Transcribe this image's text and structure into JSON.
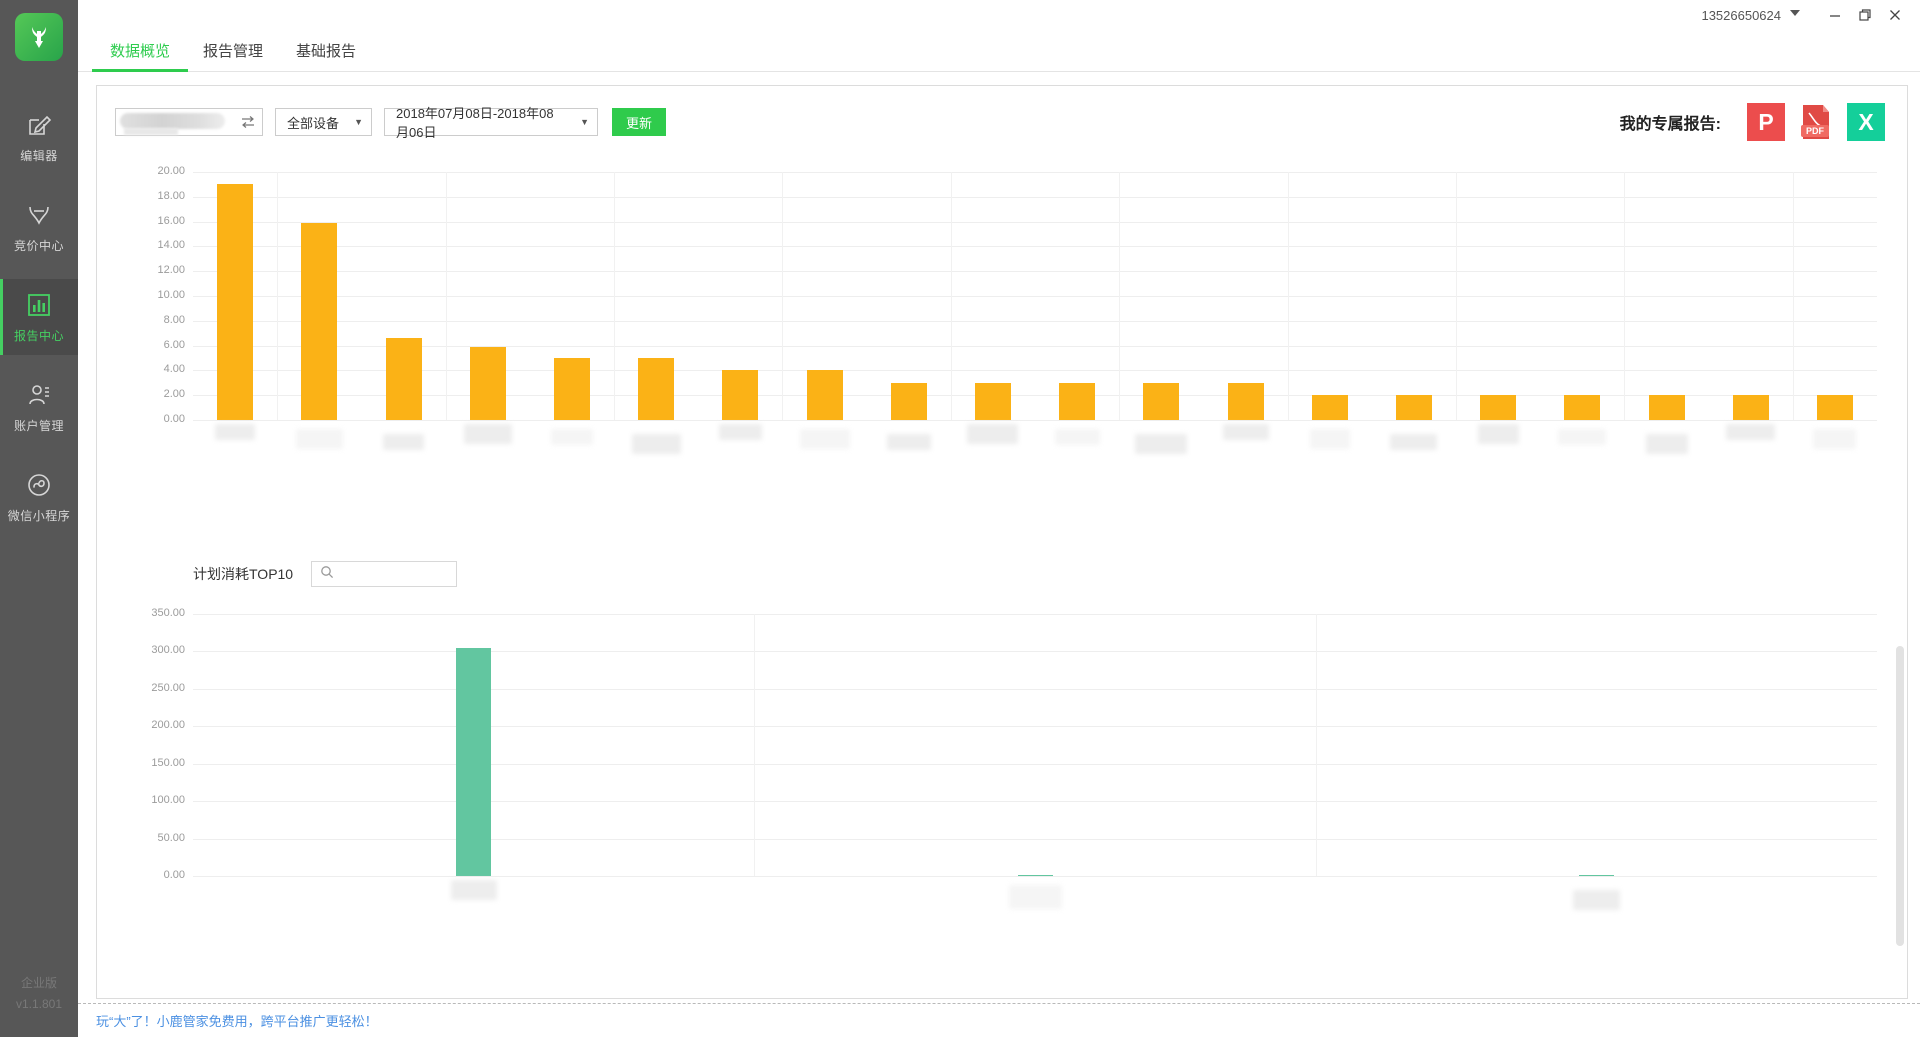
{
  "titlebar": {
    "user_id": "13526650624",
    "caret_icon": "chevron-down-icon",
    "minimize_icon": "minimize-icon",
    "maximize_icon": "maximize-icon",
    "close_icon": "close-icon"
  },
  "sidebar": {
    "logo_icon": "deer-antler-logo",
    "items": [
      {
        "label": "编辑器",
        "icon": "pencil-square-icon",
        "active": false
      },
      {
        "label": "竞价中心",
        "icon": "antler-icon",
        "active": false
      },
      {
        "label": "报告中心",
        "icon": "bar-chart-icon",
        "active": true
      },
      {
        "label": "账户管理",
        "icon": "user-settings-icon",
        "active": false
      },
      {
        "label": "微信小程序",
        "icon": "wechat-miniapp-icon",
        "active": false
      }
    ],
    "edition": "企业版",
    "version": "v1.1.801"
  },
  "tabs": [
    {
      "label": "数据概览",
      "active": true
    },
    {
      "label": "报告管理",
      "active": false
    },
    {
      "label": "基础报告",
      "active": false
    }
  ],
  "toolbar": {
    "account_value": "",
    "account_placeholder": "",
    "swap_icon": "swap-arrows-icon",
    "device_select": {
      "value": "全部设备",
      "options": [
        "全部设备"
      ]
    },
    "date_select": {
      "value": "2018年07月08日-2018年08月06日"
    },
    "update_button": "更新",
    "export_label": "我的专属报告:",
    "export_buttons": [
      {
        "name": "ppt",
        "glyph": "P"
      },
      {
        "name": "pdf",
        "glyph": "PDF"
      },
      {
        "name": "excel",
        "glyph": "X"
      }
    ]
  },
  "section2": {
    "title": "计划消耗TOP10",
    "search_placeholder": "",
    "search_value": "",
    "search_icon": "search-icon"
  },
  "footer": {
    "promo": "玩“大”了！小鹿管家免费用，跨平台推广更轻松！"
  },
  "colors": {
    "accent_green": "#2ecc4e",
    "bar_orange": "#fbb216",
    "bar_green": "#62c6a0",
    "sidebar_bg": "#575757",
    "link_blue": "#4b90e2"
  },
  "chart_data": [
    {
      "type": "bar",
      "title": "",
      "xlabel": "",
      "ylabel": "",
      "ylim": [
        0,
        20
      ],
      "yticks": [
        "0.00",
        "2.00",
        "4.00",
        "6.00",
        "8.00",
        "10.00",
        "12.00",
        "14.00",
        "16.00",
        "18.00",
        "20.00"
      ],
      "ytick_values": [
        0,
        2,
        4,
        6,
        8,
        10,
        12,
        14,
        16,
        18,
        20
      ],
      "grid": true,
      "legend": "none",
      "categories_redacted": true,
      "categories": [
        "",
        "",
        "",
        "",
        "",
        "",
        "",
        "",
        "",
        "",
        "",
        "",
        "",
        "",
        "",
        "",
        "",
        "",
        ""
      ],
      "values": [
        19.0,
        15.9,
        6.6,
        5.9,
        5.0,
        5.0,
        4.0,
        4.0,
        3.0,
        3.0,
        3.0,
        3.0,
        3.0,
        2.0,
        2.0,
        2.0,
        2.0,
        2.0,
        2.0,
        2.0
      ],
      "color": "#fbb216"
    },
    {
      "type": "bar",
      "title": "计划消耗TOP10",
      "xlabel": "",
      "ylabel": "",
      "ylim": [
        0,
        350
      ],
      "yticks": [
        "0.00",
        "50.00",
        "100.00",
        "150.00",
        "200.00",
        "250.00",
        "300.00",
        "350.00"
      ],
      "ytick_values": [
        0,
        50,
        100,
        150,
        200,
        250,
        300,
        350
      ],
      "grid": true,
      "legend": "none",
      "categories_redacted": true,
      "categories": [
        "",
        "",
        ""
      ],
      "values": [
        305.0,
        1.0,
        1.0
      ],
      "color": "#62c6a0"
    }
  ]
}
